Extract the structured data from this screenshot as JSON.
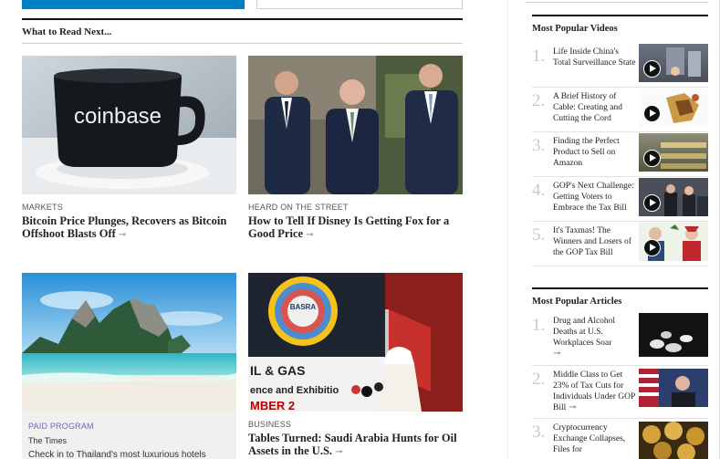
{
  "what_to_read_next": {
    "title": "What to Read Next...",
    "cards": [
      {
        "kicker": "MARKETS",
        "headline": "Bitcoin Price Plunges, Recovers as Bitcoin Offshoot Blasts Off",
        "image_text": "coinbase"
      },
      {
        "kicker": "HEARD ON THE STREET",
        "headline": "How to Tell If Disney Is Getting Fox for a Good Price"
      },
      {
        "kicker": "PAID PROGRAM",
        "sponsor": "The Times",
        "headline": "Check in to Thailand's most luxurious hotels"
      },
      {
        "kicker": "BUSINESS",
        "headline": "Tables Turned: Saudi Arabia Hunts for Oil Assets in the U.S.",
        "image_text": {
          "basra": "BASRA",
          "gas": "IL & GAS",
          "exhibition": "ence and Exhibitio",
          "lower": "MBER 2"
        }
      }
    ]
  },
  "most_popular_videos": {
    "title": "Most Popular Videos",
    "items": [
      {
        "num": "1.",
        "text": "Life Inside China's Total Surveillance State"
      },
      {
        "num": "2.",
        "text": "A Brief History of Cable: Creating and Cutting the Cord"
      },
      {
        "num": "3.",
        "text": "Finding the Perfect Product to Sell on Amazon"
      },
      {
        "num": "4.",
        "text": "GOP's Next Challenge: Getting Voters to Embrace the Tax Bill"
      },
      {
        "num": "5.",
        "text": "It's Taxmas! The Winners and Losers of the GOP Tax Bill"
      }
    ]
  },
  "most_popular_articles": {
    "title": "Most Popular Articles",
    "items": [
      {
        "num": "1.",
        "text": "Drug and Alcohol Deaths at U.S. Workplaces Soar"
      },
      {
        "num": "2.",
        "text": "Middle Class to Get 23% of Tax Cuts for Individuals Under GOP Bill"
      },
      {
        "num": "3.",
        "text": "Cryptocurrency Exchange Collapses, Files for"
      }
    ]
  },
  "icons": {
    "key": "key-icon",
    "play": "play-icon"
  },
  "colors": {
    "brand_blue": "#0080c6",
    "paid_program": "#6b6bbf"
  }
}
